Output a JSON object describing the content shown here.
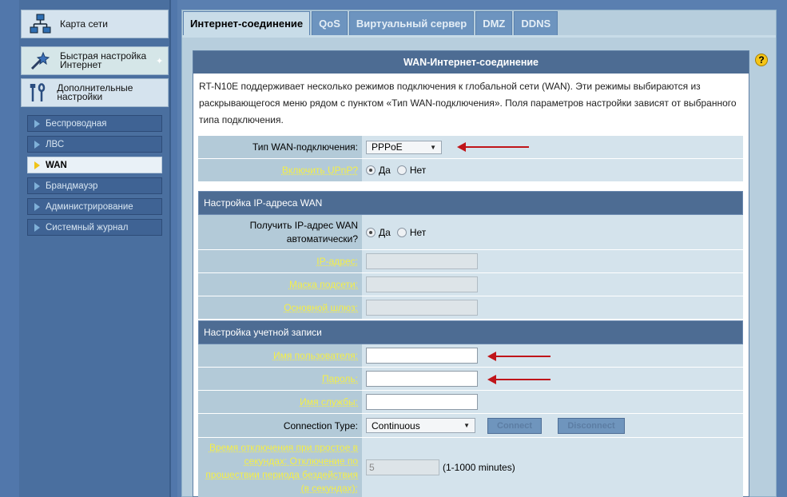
{
  "sidebar": {
    "main_items": [
      {
        "label": "Карта сети",
        "icon": "network-map-icon"
      },
      {
        "label": "Быстрая настройка Интернет",
        "icon": "magic-wand-icon"
      },
      {
        "label": "Дополнительные настройки",
        "icon": "tools-icon"
      }
    ],
    "sub_items": [
      {
        "label": "Беспроводная"
      },
      {
        "label": "ЛВС"
      },
      {
        "label": "WAN"
      },
      {
        "label": "Брандмауэр"
      },
      {
        "label": "Администрирование"
      },
      {
        "label": "Системный журнал"
      }
    ]
  },
  "tabs": [
    {
      "label": "Интернет-соединение"
    },
    {
      "label": "QoS"
    },
    {
      "label": "Виртуальный сервер"
    },
    {
      "label": "DMZ"
    },
    {
      "label": "DDNS"
    }
  ],
  "panel": {
    "title": "WAN-Интернет-соединение",
    "description": "RT-N10E поддерживает несколько режимов подключения к глобальной сети (WAN). Эти режимы выбираются из раскрывающегося меню рядом с пунктом «Тип WAN-подключения». Поля параметров настройки зависят от выбранного типа подключения."
  },
  "wan_type": {
    "label": "Тип WAN-подключения:",
    "value": "PPPoE"
  },
  "upnp": {
    "label": "Включить UPnP?",
    "yes": "Да",
    "no": "Нет"
  },
  "ip_section": {
    "title": "Настройка IP-адреса WAN",
    "auto_label": "Получить IP-адрес WAN автоматически?",
    "yes": "Да",
    "no": "Нет",
    "ip_label": "IP-адрес:",
    "mask_label": "Маска подсети:",
    "gateway_label": "Основной шлюз:"
  },
  "account_section": {
    "title": "Настройка учетной записи",
    "username_label": "Имя пользователя:",
    "password_label": "Пароль:",
    "service_label": "Имя службы:",
    "conn_type_label": "Connection Type:",
    "conn_type_value": "Continuous",
    "connect_btn": "Connect",
    "disconnect_btn": "Disconnect",
    "idle_label": "Время отключения при простое в секундах: Отключение по прошествии периода бездействия (в секундах):",
    "idle_value": "5",
    "idle_hint": "(1-1000 minutes)"
  },
  "help_icon": "?"
}
